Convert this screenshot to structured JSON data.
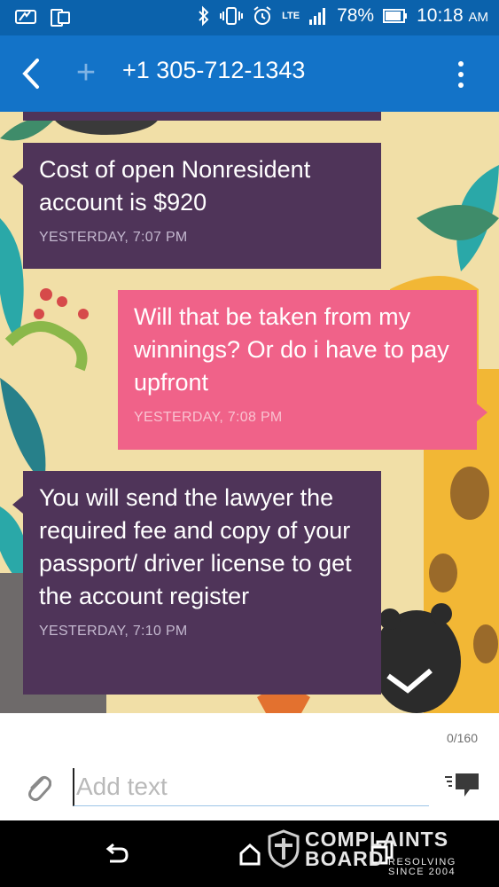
{
  "status_bar": {
    "network": "LTE",
    "battery": "78%",
    "time": "10:18",
    "ampm": "AM"
  },
  "toolbar": {
    "title": "+1 305-712-1343",
    "icons": [
      "back-arrow-icon",
      "add-icon",
      "overflow-menu-icon"
    ]
  },
  "conversation": {
    "messages": [
      {
        "direction": "incoming",
        "text": "Cost of open Nonresident account is $920",
        "time": "YESTERDAY, 7:07 PM"
      },
      {
        "direction": "outgoing",
        "text": "Will that be taken from my winnings? Or do i have to pay upfront",
        "time": "YESTERDAY, 7:08 PM"
      },
      {
        "direction": "incoming",
        "text": "You will send the lawyer the required fee and copy of your passport/ driver license to get the account register",
        "time": "YESTERDAY, 7:10 PM"
      }
    ],
    "colors": {
      "incoming": "#4f3459",
      "outgoing": "#f06289",
      "background": "#f1dfa7"
    }
  },
  "compose": {
    "counter": "0/160",
    "placeholder": "Add text",
    "value": ""
  },
  "watermark": {
    "brand_line1": "COMPLAINTS",
    "brand_line2": "BOARD",
    "tagline": "RESOLVING SINCE 2004"
  },
  "colors": {
    "status_bar": "#0b62ac",
    "toolbar": "#1373c8"
  }
}
